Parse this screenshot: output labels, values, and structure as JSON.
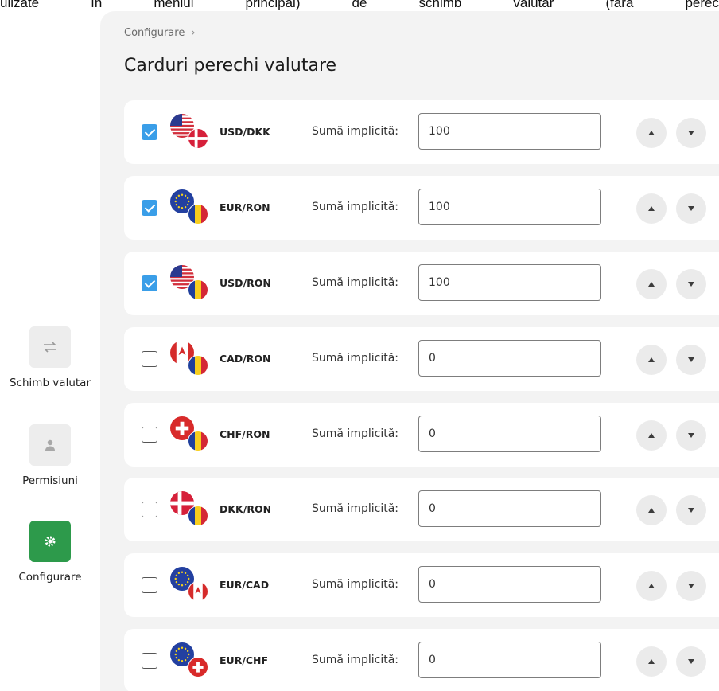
{
  "top_text": [
    "ulizate",
    "în",
    "meniul",
    "principal)",
    "de",
    "schimb",
    "valutar",
    "(fără",
    "perec"
  ],
  "sidebar": {
    "items": [
      {
        "label": "Schimb valutar",
        "icon": "exchange-icon",
        "active": false
      },
      {
        "label": "Permisiuni",
        "icon": "user-icon",
        "active": false
      },
      {
        "label": "Configurare",
        "icon": "gear-icon",
        "active": true
      }
    ]
  },
  "breadcrumb": {
    "label": "Configurare",
    "separator": "›"
  },
  "page": {
    "title": "Carduri perechi valutare"
  },
  "colors": {
    "accent": "#2d9a4b",
    "checkbox": "#3a9ee8",
    "background": "#f3f3f3"
  },
  "cards": [
    {
      "pair": "USD/DKK",
      "checked": true,
      "amount_label": "Sumă implicită:",
      "amount": "100",
      "flag_main": "us",
      "flag_second": "dk"
    },
    {
      "pair": "EUR/RON",
      "checked": true,
      "amount_label": "Sumă implicită:",
      "amount": "100",
      "flag_main": "eu",
      "flag_second": "ro"
    },
    {
      "pair": "USD/RON",
      "checked": true,
      "amount_label": "Sumă implicită:",
      "amount": "100",
      "flag_main": "us",
      "flag_second": "ro"
    },
    {
      "pair": "CAD/RON",
      "checked": false,
      "amount_label": "Sumă implicită:",
      "amount": "0",
      "flag_main": "ca",
      "flag_second": "ro"
    },
    {
      "pair": "CHF/RON",
      "checked": false,
      "amount_label": "Sumă implicită:",
      "amount": "0",
      "flag_main": "ch",
      "flag_second": "ro"
    },
    {
      "pair": "DKK/RON",
      "checked": false,
      "amount_label": "Sumă implicită:",
      "amount": "0",
      "flag_main": "dk",
      "flag_second": "ro"
    },
    {
      "pair": "EUR/CAD",
      "checked": false,
      "amount_label": "Sumă implicită:",
      "amount": "0",
      "flag_main": "eu",
      "flag_second": "ca"
    },
    {
      "pair": "EUR/CHF",
      "checked": false,
      "amount_label": "Sumă implicită:",
      "amount": "0",
      "flag_main": "eu",
      "flag_second": "ch"
    }
  ]
}
